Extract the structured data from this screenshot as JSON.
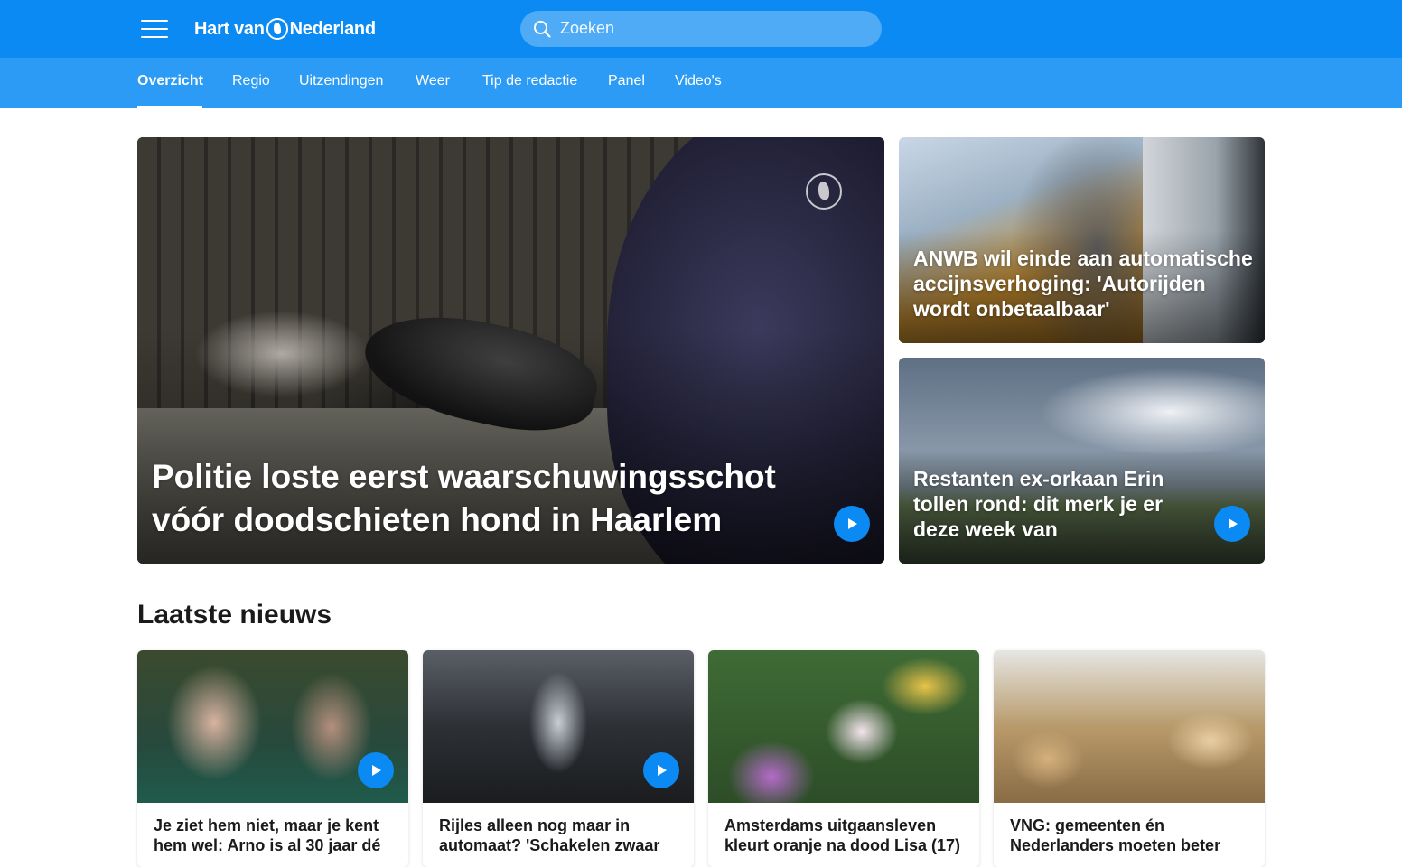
{
  "header": {
    "logo_text_left": "Hart van",
    "logo_text_right": "Nederland",
    "search_placeholder": "Zoeken"
  },
  "nav": {
    "items": [
      {
        "label": "Overzicht",
        "active": true
      },
      {
        "label": "Regio"
      },
      {
        "label": "Uitzendingen"
      },
      {
        "label": "Weer"
      },
      {
        "label": "Tip de redactie"
      },
      {
        "label": "Panel"
      },
      {
        "label": "Video's"
      }
    ]
  },
  "hero": {
    "main": {
      "title": "Politie loste eerst waarschuwingsschot vóór doodschieten hond in Haarlem",
      "has_video": true
    },
    "side_top": {
      "title": "ANWB wil einde aan automatische accijnsverhoging: 'Autorijden wordt onbetaalbaar'",
      "has_video": false
    },
    "side_bottom": {
      "title": "Restanten ex-orkaan Erin tollen rond: dit merk je er deze week van",
      "has_video": true
    }
  },
  "latest": {
    "title": "Laatste nieuws",
    "items": [
      {
        "title": "Je ziet hem niet, maar je kent hem wel: Arno is al 30 jaar dé",
        "has_video": true
      },
      {
        "title": "Rijles alleen nog maar in automaat? 'Schakelen zwaar",
        "has_video": true
      },
      {
        "title": "Amsterdams uitgaansleven kleurt oranje na dood Lisa (17)",
        "has_video": false
      },
      {
        "title": "VNG: gemeenten én Nederlanders moeten beter",
        "has_video": false
      }
    ]
  },
  "colors": {
    "topbar": "#0a8af2",
    "nav": "#2b9bf5",
    "accent_play": "#0a8af2"
  }
}
